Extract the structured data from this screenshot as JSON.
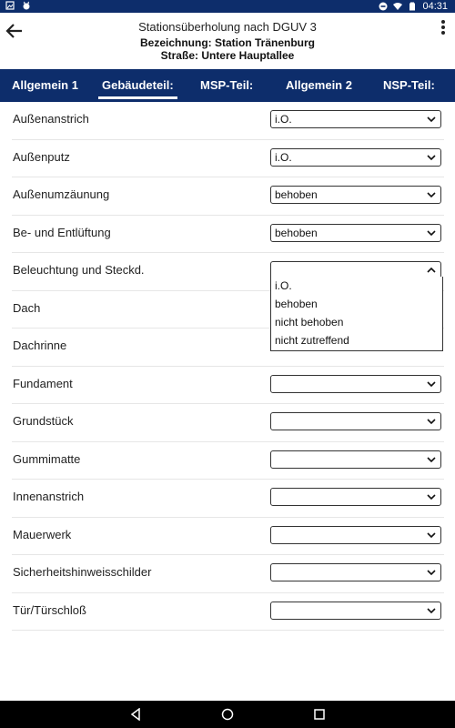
{
  "status_bar": {
    "time": "04:31"
  },
  "header": {
    "title": "Stationsüberholung nach DGUV 3",
    "subtitle_line1": "Bezeichnung: Station Tränenburg",
    "subtitle_line2": "Straße: Untere Hauptallee"
  },
  "tabs": [
    {
      "label": "Allgemein 1",
      "active": false
    },
    {
      "label": "Gebäudeteil:",
      "active": true
    },
    {
      "label": "MSP-Teil:",
      "active": false
    },
    {
      "label": "Allgemein 2",
      "active": false
    },
    {
      "label": "NSP-Teil:",
      "active": false
    }
  ],
  "rows": [
    {
      "label": "Außenanstrich",
      "value": "i.O."
    },
    {
      "label": "Außenputz",
      "value": "i.O."
    },
    {
      "label": "Außenumzäunung",
      "value": "behoben"
    },
    {
      "label": "Be- und Entlüftung",
      "value": "behoben"
    },
    {
      "label": "Beleuchtung und Steckd.",
      "value": ""
    },
    {
      "label": "Dach",
      "value": ""
    },
    {
      "label": "Dachrinne",
      "value": ""
    },
    {
      "label": "Fundament",
      "value": ""
    },
    {
      "label": "Grundstück",
      "value": ""
    },
    {
      "label": "Gummimatte",
      "value": ""
    },
    {
      "label": "Innenanstrich",
      "value": ""
    },
    {
      "label": "Mauerwerk",
      "value": ""
    },
    {
      "label": "Sicherheitshinweisschilder",
      "value": ""
    },
    {
      "label": "Tür/Türschloß",
      "value": ""
    }
  ],
  "dropdown_options": [
    "i.O.",
    "behoben",
    "nicht behoben",
    "nicht zutreffend"
  ],
  "colors": {
    "accent": "#0d2d6b"
  }
}
